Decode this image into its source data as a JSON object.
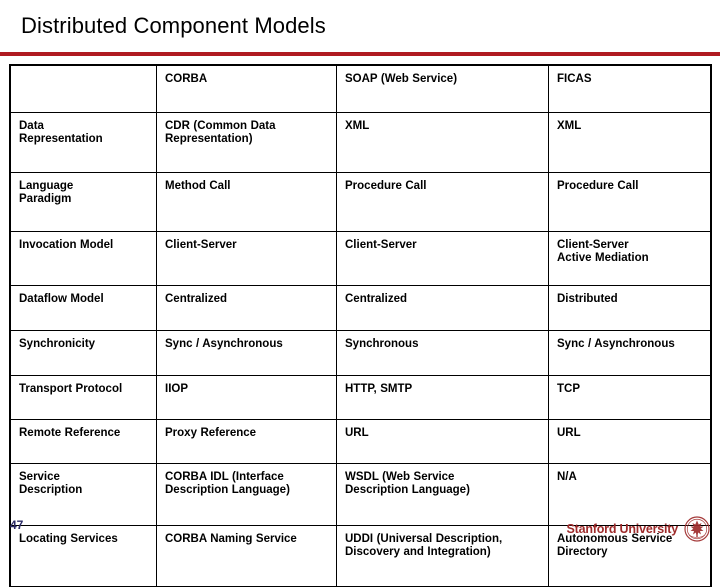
{
  "slide": {
    "title": "Distributed Component Models",
    "accent_color": "#B01A21",
    "page_number": "47",
    "page_number_color": "#2B2B66",
    "brand_name": "Stanford University",
    "brand_color": "#9E2B2B",
    "seal_icon": "stanford-seal-icon"
  },
  "table": {
    "headers": [
      "",
      "CORBA",
      "SOAP (Web Service)",
      "FICAS"
    ],
    "rows": [
      {
        "label": "Data\nRepresentation",
        "corba": "CDR (Common Data\nRepresentation)",
        "soap": "XML",
        "ficas": "XML"
      },
      {
        "label": "Language\nParadigm",
        "corba": "Method Call",
        "soap": "Procedure Call",
        "ficas": "Procedure Call"
      },
      {
        "label": "Invocation Model",
        "corba": "Client-Server",
        "soap": "Client-Server",
        "ficas": "Client-Server\nActive Mediation"
      },
      {
        "label": "Dataflow Model",
        "corba": "Centralized",
        "soap": "Centralized",
        "ficas": "Distributed"
      },
      {
        "label": "Synchronicity",
        "corba": "Sync / Asynchronous",
        "soap": "Synchronous",
        "ficas": "Sync / Asynchronous"
      },
      {
        "label": "Transport Protocol",
        "corba": "IIOP",
        "soap": "HTTP, SMTP",
        "ficas": "TCP"
      },
      {
        "label": "Remote Reference",
        "corba": "Proxy Reference",
        "soap": "URL",
        "ficas": "URL"
      },
      {
        "label": "Service\nDescription",
        "corba": "CORBA IDL (Interface\nDescription Language)",
        "soap": "WSDL (Web Service\nDescription Language)",
        "ficas": "N/A"
      },
      {
        "label": "Locating Services",
        "corba": "CORBA Naming Service",
        "soap": "UDDI (Universal Description,\nDiscovery and Integration)",
        "ficas": "Autonomous Service\nDirectory"
      }
    ]
  }
}
